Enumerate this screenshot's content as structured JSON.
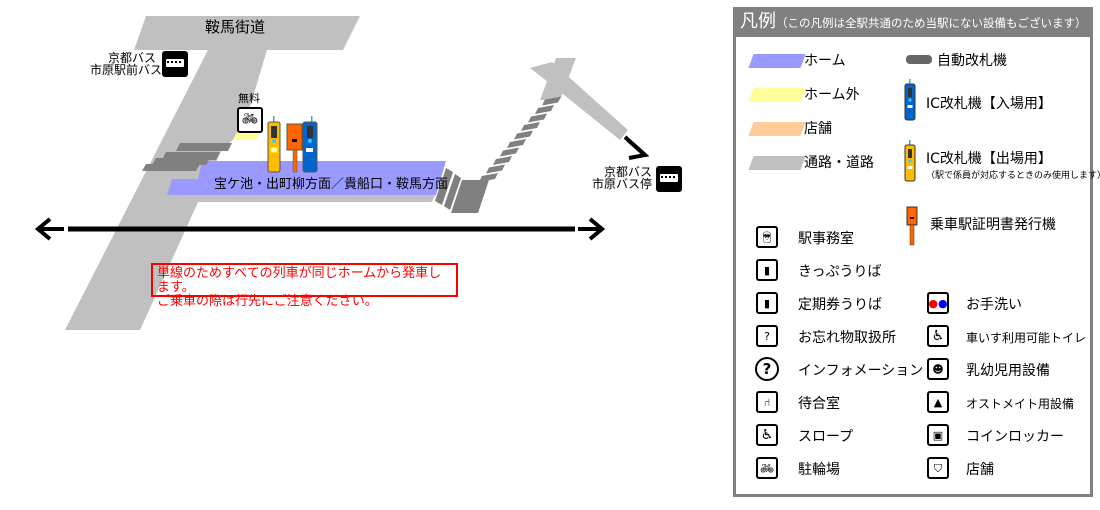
{
  "map": {
    "road_name": "鞍馬街道",
    "bus_stop_north": {
      "line1": "京都バス",
      "line2": "市原駅前バス停",
      "icon": "bus-icon"
    },
    "bus_stop_east": {
      "line1": "京都バス",
      "line2": "市原バス停",
      "icon": "bus-icon"
    },
    "bicycle_parking": {
      "label": "無料",
      "icon": "bicycle-icon"
    },
    "platform_label": "宝ケ池・出町柳方面／貴船口・鞍馬方面",
    "notice_line1": "単線のためすべての列車が同じホームから発車します。",
    "notice_line2": "ご乗車の際は行先にご注意ください。",
    "colors": {
      "platform": "#9999ff",
      "outside_platform": "#ffff99",
      "shop": "#ffcc99",
      "road": "#c0c0c0",
      "stairs": "#808080",
      "ic_in": "#0066cc",
      "ic_out": "#ffbb00",
      "certificate_machine": "#ff6600",
      "notice": "#ff0000"
    }
  },
  "legend": {
    "title": "凡例",
    "subtitle": "（この凡例は全駅共通のため当駅にない設備もございます）",
    "areas": [
      {
        "label": "ホーム",
        "color": "#9999ff"
      },
      {
        "label": "ホーム外",
        "color": "#ffff99"
      },
      {
        "label": "店舗",
        "color": "#ffcc99"
      },
      {
        "label": "通路・道路",
        "color": "#c0c0c0"
      }
    ],
    "gates": [
      {
        "label": "自動改札機",
        "icon": "ticket-gate-icon"
      },
      {
        "label": "IC改札機【入場用】",
        "icon": "ic-gate-entry-icon"
      },
      {
        "label": "IC改札機【出場用】",
        "note": "（駅で係員が対応するときのみ使用します）",
        "icon": "ic-gate-exit-icon"
      },
      {
        "label": "乗車駅証明書発行機",
        "icon": "certificate-machine-icon"
      }
    ],
    "facilities_left": [
      {
        "label": "駅事務室",
        "icon": "station-office-icon"
      },
      {
        "label": "きっぷうりば",
        "icon": "ticket-counter-icon"
      },
      {
        "label": "定期券うりば",
        "icon": "commuter-pass-counter-icon"
      },
      {
        "label": "お忘れ物取扱所",
        "icon": "lost-and-found-icon"
      },
      {
        "label": "インフォメーション",
        "icon": "information-icon"
      },
      {
        "label": "待合室",
        "icon": "waiting-room-icon"
      },
      {
        "label": "スロープ",
        "icon": "slope-icon"
      },
      {
        "label": "駐輪場",
        "icon": "bicycle-parking-icon"
      }
    ],
    "facilities_right": [
      {
        "label": "お手洗い",
        "icon": "restroom-icon"
      },
      {
        "label": "車いす利用可能トイレ",
        "icon": "wheelchair-toilet-icon"
      },
      {
        "label": "乳幼児用設備",
        "icon": "baby-facility-icon"
      },
      {
        "label": "オストメイト用設備",
        "icon": "ostomate-icon"
      },
      {
        "label": "コインロッカー",
        "icon": "coin-locker-icon"
      },
      {
        "label": "店舗",
        "icon": "shop-icon"
      }
    ]
  }
}
